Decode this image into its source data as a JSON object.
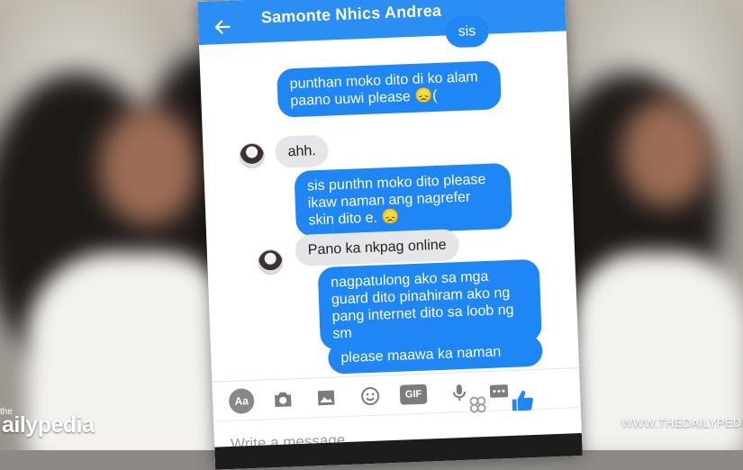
{
  "header": {
    "title": "Samonte Nhics Andrea"
  },
  "messages": [
    {
      "from": "me",
      "text": "sis"
    },
    {
      "from": "me",
      "text": "punthan moko dito di ko alam paano uuwi please 😞("
    },
    {
      "from": "them",
      "text": "ahh."
    },
    {
      "from": "me",
      "text": "sis punthn moko dito please ikaw naman ang nagrefer skin dito e. 😞"
    },
    {
      "from": "them",
      "text": "Pano ka nkpag online"
    },
    {
      "from": "me",
      "text": "nagpatulong ako sa mga guard dito pinahiram ako ng pang internet dito sa loob ng sm"
    },
    {
      "from": "me",
      "text": "please maawa ka naman"
    }
  ],
  "toolbar": {
    "text_label": "Aa",
    "gif_label": "GIF",
    "icons": [
      "camera-icon",
      "gallery-icon",
      "emoji-icon",
      "gif-icon",
      "microphone-icon",
      "more-icon"
    ]
  },
  "composer": {
    "placeholder": "Write a message..."
  },
  "watermark": {
    "brand_small": "the",
    "brand_main": "ailypedia",
    "site": "WWW.THEDAILYPEDIA"
  },
  "colors": {
    "accent": "#2b8ef2",
    "outgoing_bubble": "#1f86f5",
    "incoming_bubble": "#e6e6e9"
  }
}
